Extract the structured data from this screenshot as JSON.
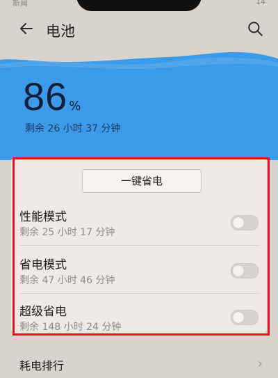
{
  "status": {
    "left": "新闻",
    "right": "14"
  },
  "header": {
    "title": "电池",
    "back_icon": "arrow-left-icon",
    "search_icon": "search-icon"
  },
  "battery": {
    "percent": "86",
    "percent_symbol": "%",
    "remaining": "剩余 26 小时 37 分钟",
    "panel_color": "#3c9be9"
  },
  "one_key": {
    "label": "一键省电"
  },
  "modes": [
    {
      "name": "性能模式",
      "remaining": "剩余 25 小时 17 分钟",
      "enabled": false
    },
    {
      "name": "省电模式",
      "remaining": "剩余 47 小时 46 分钟",
      "enabled": false
    },
    {
      "name": "超级省电",
      "remaining": "剩余 148 小时 24 分钟",
      "enabled": false
    }
  ],
  "ranking": {
    "label": "耗电排行",
    "chevron": "›"
  },
  "highlight_color": "#e8101a"
}
